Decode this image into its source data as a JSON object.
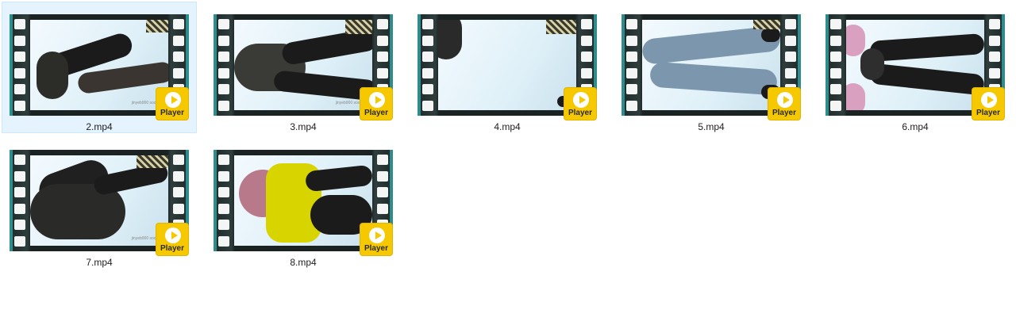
{
  "files": [
    {
      "name": "2.mp4",
      "selected": true,
      "badge": "Player",
      "watermark": "jinyeb000 sooiddu"
    },
    {
      "name": "3.mp4",
      "selected": false,
      "badge": "Player",
      "watermark": "jinyeb000 sooiddu"
    },
    {
      "name": "4.mp4",
      "selected": false,
      "badge": "Player",
      "watermark": ""
    },
    {
      "name": "5.mp4",
      "selected": false,
      "badge": "Player",
      "watermark": ""
    },
    {
      "name": "6.mp4",
      "selected": false,
      "badge": "Player",
      "watermark": ""
    },
    {
      "name": "7.mp4",
      "selected": false,
      "badge": "Player",
      "watermark": "jinyeb000 sooiddu"
    },
    {
      "name": "8.mp4",
      "selected": false,
      "badge": "Player",
      "watermark": ""
    }
  ],
  "colors": {
    "selection_bg": "#e5f3ff",
    "selection_border": "#cce8ff",
    "badge": "#f5c800",
    "film_edge": "#2d8c8c"
  },
  "icons": {
    "badge_icon": "play-icon",
    "thumbnail": "video-film-icon"
  }
}
